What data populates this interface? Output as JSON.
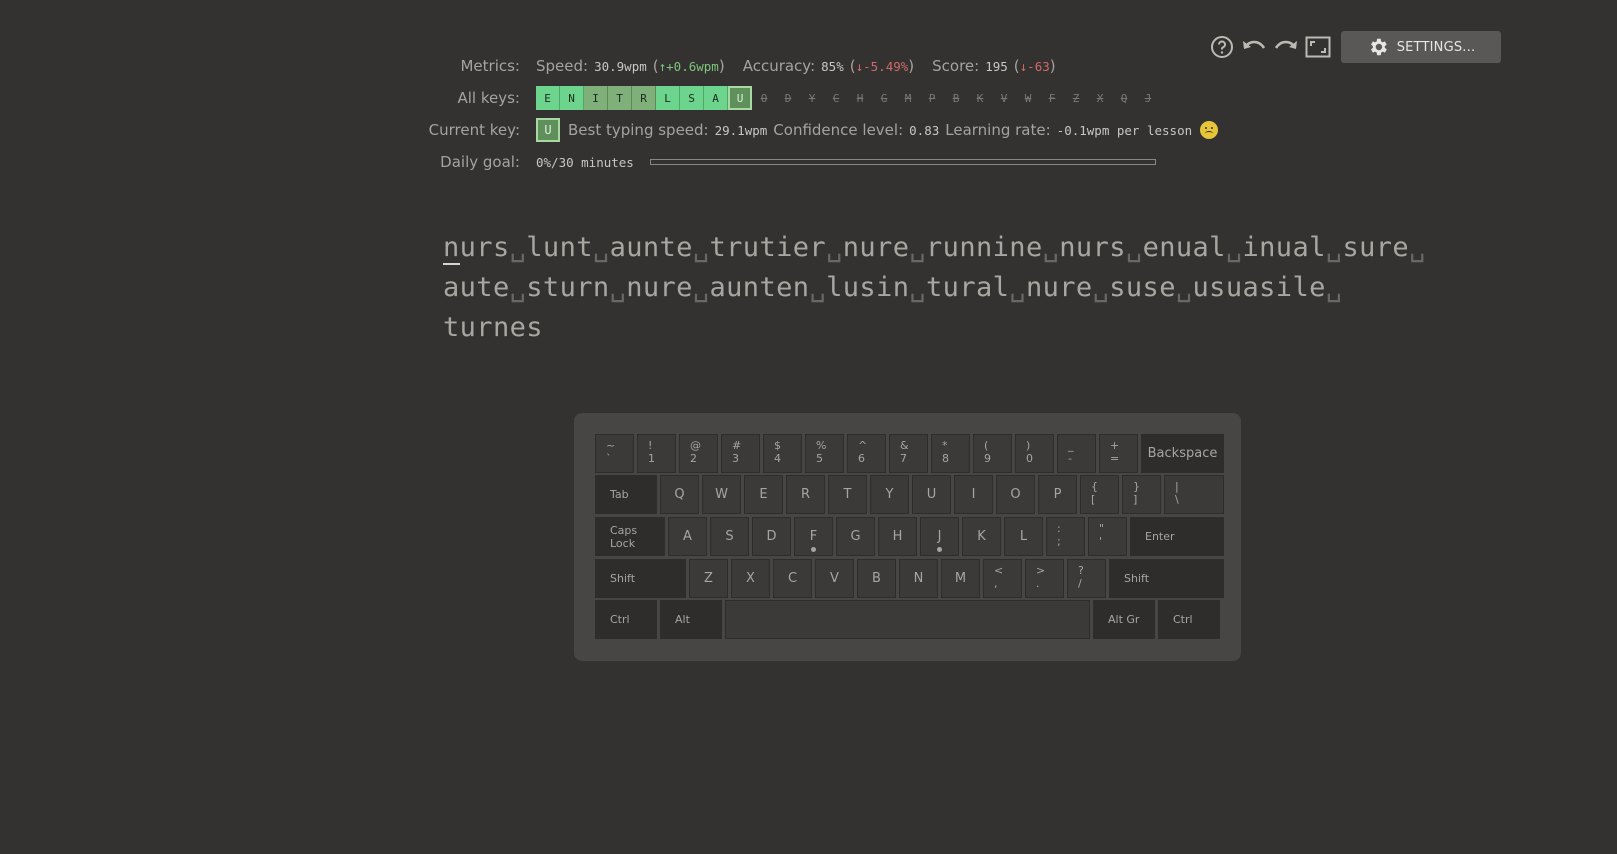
{
  "toolbar": {
    "help_icon": "help-icon",
    "undo_icon": "undo-icon",
    "redo_icon": "redo-icon",
    "fullscreen_icon": "fullscreen-icon",
    "settings_label": "SETTINGS..."
  },
  "metrics": {
    "metrics_label": "Metrics:",
    "speed_label": "Speed:",
    "speed_value": "30.9wpm",
    "speed_delta": "↑+0.6wpm",
    "accuracy_label": "Accuracy:",
    "accuracy_value": "85%",
    "accuracy_delta": "↓-5.49%",
    "score_label": "Score:",
    "score_value": "195",
    "score_delta": "↓-63",
    "all_keys_label": "All keys:",
    "all_keys": [
      {
        "k": "E",
        "state": "on"
      },
      {
        "k": "N",
        "state": "on"
      },
      {
        "k": "I",
        "state": "mid"
      },
      {
        "k": "T",
        "state": "mid"
      },
      {
        "k": "R",
        "state": "mid"
      },
      {
        "k": "L",
        "state": "on"
      },
      {
        "k": "S",
        "state": "on"
      },
      {
        "k": "A",
        "state": "on"
      },
      {
        "k": "U",
        "state": "cur"
      },
      {
        "k": "O",
        "state": "off"
      },
      {
        "k": "D",
        "state": "off"
      },
      {
        "k": "Y",
        "state": "off"
      },
      {
        "k": "C",
        "state": "off"
      },
      {
        "k": "H",
        "state": "off"
      },
      {
        "k": "G",
        "state": "off"
      },
      {
        "k": "M",
        "state": "off"
      },
      {
        "k": "P",
        "state": "off"
      },
      {
        "k": "B",
        "state": "off"
      },
      {
        "k": "K",
        "state": "off"
      },
      {
        "k": "V",
        "state": "off"
      },
      {
        "k": "W",
        "state": "off"
      },
      {
        "k": "F",
        "state": "off"
      },
      {
        "k": "Z",
        "state": "off"
      },
      {
        "k": "X",
        "state": "off"
      },
      {
        "k": "Q",
        "state": "off"
      },
      {
        "k": "J",
        "state": "off"
      }
    ],
    "current_key_label": "Current key:",
    "current_key": "U",
    "best_speed_label": "Best typing speed:",
    "best_speed_value": "29.1wpm",
    "confidence_label": "Confidence level:",
    "confidence_value": "0.83",
    "learning_rate_label": "Learning rate:",
    "learning_rate_value": "-0.1wpm per lesson",
    "daily_goal_label": "Daily goal:",
    "daily_goal_value": "0%/30 minutes",
    "daily_goal_progress": 0
  },
  "lesson": {
    "lines": [
      [
        "nurs",
        "lunt",
        "aunte",
        "trutier",
        "nure",
        "runnine",
        "nurs",
        "enual",
        "inual",
        "sure"
      ],
      [
        "aute",
        "sturn",
        "nure",
        "aunten",
        "lusin",
        "tural",
        "nure",
        "suse",
        "usuasile"
      ],
      [
        "turnes"
      ]
    ],
    "space_glyph": "␣"
  },
  "keyboard": {
    "row1": [
      {
        "top": "~",
        "bot": "`"
      },
      {
        "top": "!",
        "bot": "1"
      },
      {
        "top": "@",
        "bot": "2"
      },
      {
        "top": "#",
        "bot": "3"
      },
      {
        "top": "$",
        "bot": "4"
      },
      {
        "top": "%",
        "bot": "5"
      },
      {
        "top": "^",
        "bot": "6"
      },
      {
        "top": "&",
        "bot": "7"
      },
      {
        "top": "*",
        "bot": "8"
      },
      {
        "top": "(",
        "bot": "9"
      },
      {
        "top": ")",
        "bot": "0"
      },
      {
        "top": "_",
        "bot": "-"
      },
      {
        "top": "+",
        "bot": "="
      }
    ],
    "backspace": "Backspace",
    "tab": "Tab",
    "row2": [
      "Q",
      "W",
      "E",
      "R",
      "T",
      "Y",
      "U",
      "I",
      "O",
      "P"
    ],
    "row2_sym": [
      {
        "top": "{",
        "bot": "["
      },
      {
        "top": "}",
        "bot": "]"
      },
      {
        "top": "|",
        "bot": "\\"
      }
    ],
    "caps": "Caps Lock",
    "row3": [
      "A",
      "S",
      "D",
      "F",
      "G",
      "H",
      "J",
      "K",
      "L"
    ],
    "row3_sym": [
      {
        "top": ":",
        "bot": ";"
      },
      {
        "top": "\"",
        "bot": "'"
      }
    ],
    "enter": "Enter",
    "shift": "Shift",
    "row4": [
      "Z",
      "X",
      "C",
      "V",
      "B",
      "N",
      "M"
    ],
    "row4_sym": [
      {
        "top": "<",
        "bot": ","
      },
      {
        "top": ">",
        "bot": "."
      },
      {
        "top": "?",
        "bot": "/"
      }
    ],
    "ctrl": "Ctrl",
    "alt": "Alt",
    "altgr": "Alt Gr"
  }
}
